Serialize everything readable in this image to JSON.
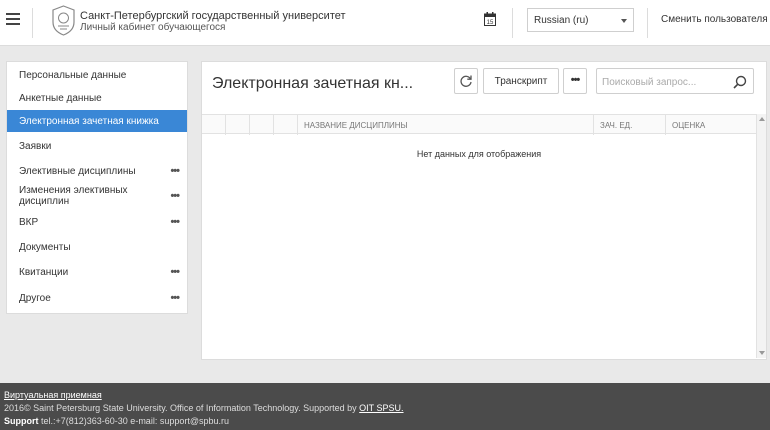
{
  "header": {
    "university_name": "Санкт-Петербургский государственный университет",
    "cabinet_title": "Личный кабинет обучающегося",
    "calendar_day": "15",
    "language_selected": "Russian (ru)",
    "change_user_label": "Сменить пользователя"
  },
  "sidebar": {
    "items": [
      {
        "label": "Персональные данные",
        "has_more": false
      },
      {
        "label": "Анкетные данные",
        "has_more": false
      },
      {
        "label": "Электронная зачетная книжка",
        "has_more": false
      },
      {
        "label": "Заявки",
        "has_more": false
      },
      {
        "label": "Элективные дисциплины",
        "has_more": true
      },
      {
        "label": "Изменения элективных",
        "label2": "дисциплин",
        "has_more": true
      },
      {
        "label": "ВКР",
        "has_more": true
      },
      {
        "label": "Документы",
        "has_more": false
      },
      {
        "label": "Квитанции",
        "has_more": true
      },
      {
        "label": "Другое",
        "has_more": true
      }
    ],
    "more_glyph": "•••",
    "active_index": 2
  },
  "main": {
    "title": "Электронная зачетная кн...",
    "transcript_label": "Транскрипт",
    "more_label": "•••",
    "search_placeholder": "Поисковый запрос...",
    "columns": {
      "discipline": "НАЗВАНИЕ ДИСЦИПЛИНЫ",
      "credits": "ЗАЧ. ЕД.",
      "grade": "ОЦЕНКА"
    },
    "no_data": "Нет данных для отображения"
  },
  "footer": {
    "virtual_reception": "Виртуальная приемная",
    "copyright_text": "2016© Saint Petersburg State University. Office of Information Technology. Supported by ",
    "copyright_link": "OIT SPSU.",
    "support_label": "Support",
    "support_contacts": " tel.:+7(812)363-60-30 e-mail: support@spbu.ru"
  },
  "colors": {
    "accent": "#3a87d6",
    "footer_bg": "#4b4b4b",
    "page_bg": "#e9e9e9"
  }
}
